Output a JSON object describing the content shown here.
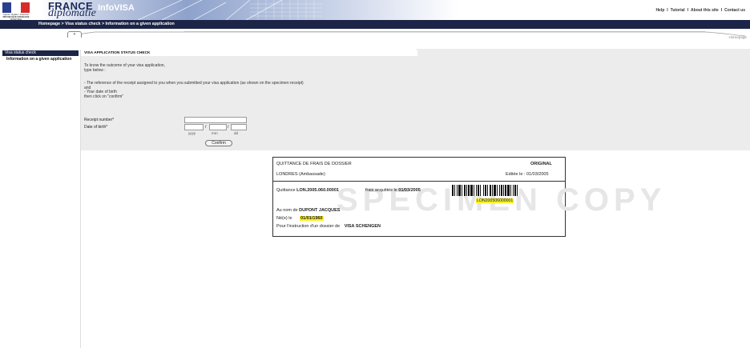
{
  "header": {
    "rf_logo_text": [
      "Liberté • Égalité • Fraternité",
      "RÉPUBLIQUE FRANÇAISE",
      "MINISTÈRE",
      "DES AFFAIRES ÉTRANGÈRES"
    ],
    "brand_france": "FRANCE",
    "brand_diplomatie": "diplomatie",
    "app_name": "InfoVISA",
    "top_links": [
      "Help",
      "Tutorial",
      "About this site",
      "Contact us"
    ],
    "breadcrumb": "Homepage > Visa status check > Information on a given application",
    "homepage_link": "Homepage"
  },
  "sidebar": {
    "active_item": "Visa status check",
    "items": [
      "Information on a given application"
    ]
  },
  "form": {
    "title": "Visa application status check",
    "intro_lines": [
      "To know the outcome of your visa application,",
      "type below :"
    ],
    "instructions": [
      "- The reference of the receipt assigned to you when you submitted your visa application (as shown on the specimen receipt)",
      "and",
      "- Your date of birth",
      "then click on \"confirm\""
    ],
    "receipt_label": "Receipt number*",
    "dob_label": "Date of birth*",
    "receipt_value": "",
    "dob_day": "",
    "dob_month": "",
    "dob_year": "",
    "hint_yyyy": "yyyy",
    "hint_mm": "mm",
    "hint_dd": "dd",
    "confirm_label": "Confirm"
  },
  "receipt_specimen": {
    "title": "QUITTANCE DE FRAIS DE DOSSIER",
    "original": "ORIGINAL",
    "office": "LONDRES (Ambassade)",
    "edited_label": "Editée le :",
    "edited_date": "01/03/2005",
    "quittance_label": "Quittance",
    "quittance_no": "LON.2005.060.00001",
    "fees_label": "frais acquittés le",
    "fees_date": "01/03/2005",
    "barcode_text": "LON200506000001",
    "name_label": "Au nom de",
    "name_value": "DUPONT JACQUES",
    "born_label": "Né(e) le",
    "born_value": "01/01/1960",
    "purpose_label": "Pour l'instruction d'un dossier de",
    "purpose_value": "VISA SCHENGEN",
    "watermark": "SPECIMEN COPY"
  },
  "colors": {
    "navy": "#1c2547",
    "panel_bg": "#ececec",
    "highlight": "#f7f12c"
  }
}
